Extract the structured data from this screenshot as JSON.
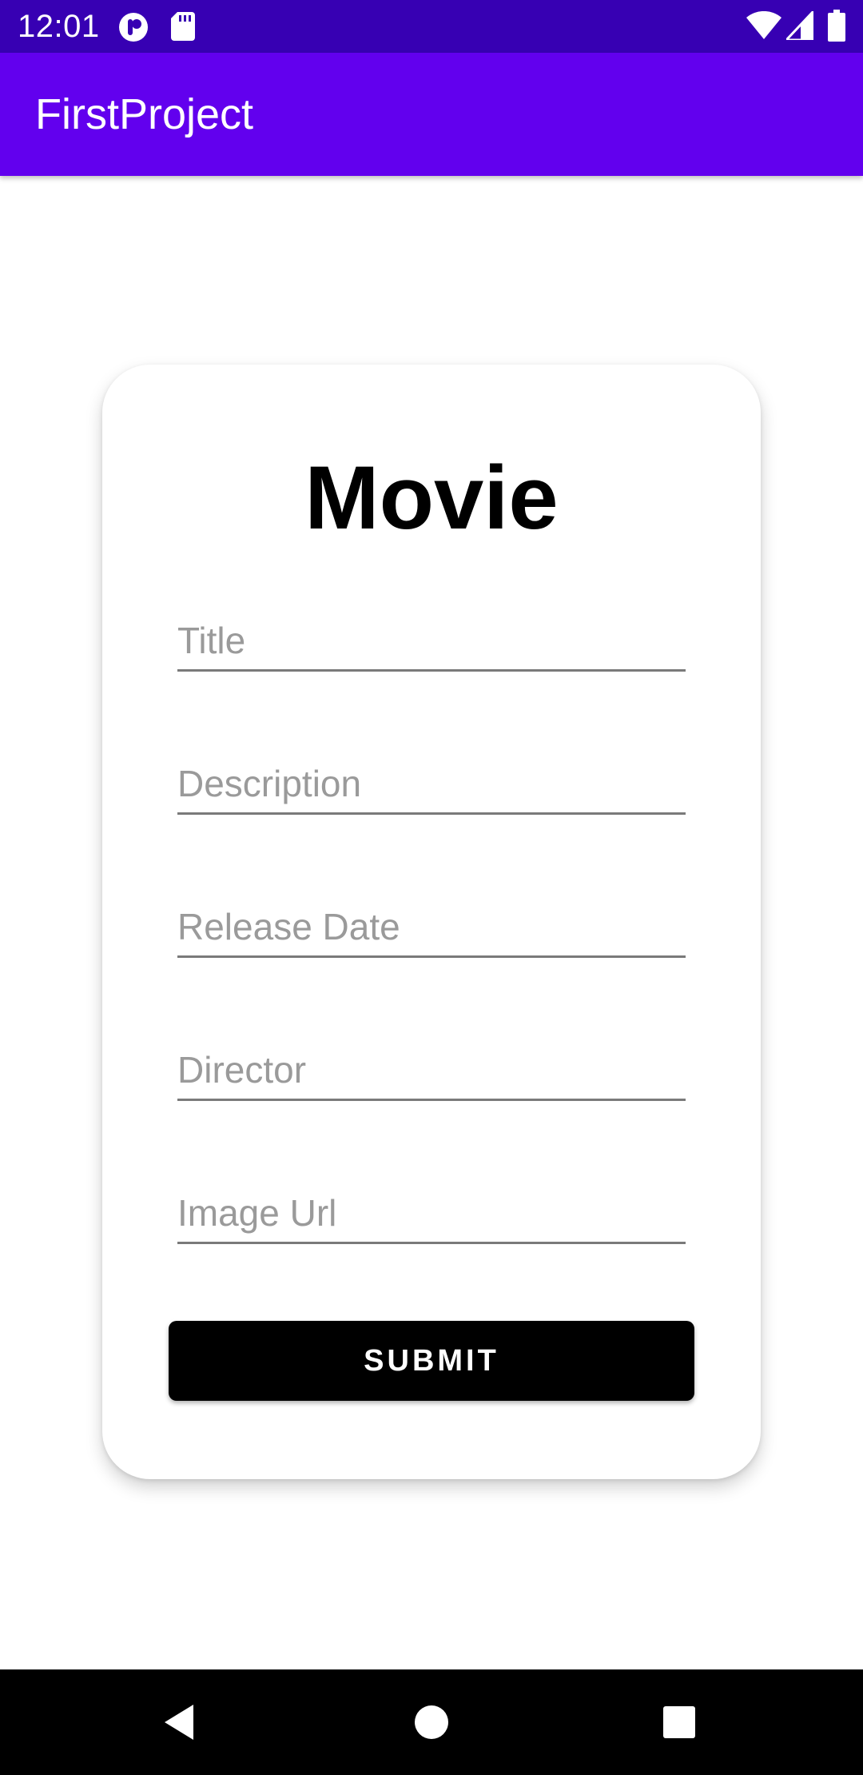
{
  "status_bar": {
    "time": "12:01",
    "icons": [
      "app-notification-icon",
      "sd-card-icon",
      "wifi-icon",
      "cell-signal-icon",
      "battery-icon"
    ],
    "background_color": "#3700B3"
  },
  "app_bar": {
    "title": "FirstProject",
    "background_color": "#6200EE"
  },
  "form": {
    "heading": "Movie",
    "fields": [
      {
        "placeholder": "Title",
        "value": ""
      },
      {
        "placeholder": "Description",
        "value": ""
      },
      {
        "placeholder": "Release Date",
        "value": ""
      },
      {
        "placeholder": "Director",
        "value": ""
      },
      {
        "placeholder": "Image Url",
        "value": ""
      }
    ],
    "submit_label": "SUBMIT",
    "submit_color": "#000000"
  },
  "nav_bar": {
    "buttons": [
      "back-icon",
      "home-icon",
      "recents-icon"
    ]
  }
}
